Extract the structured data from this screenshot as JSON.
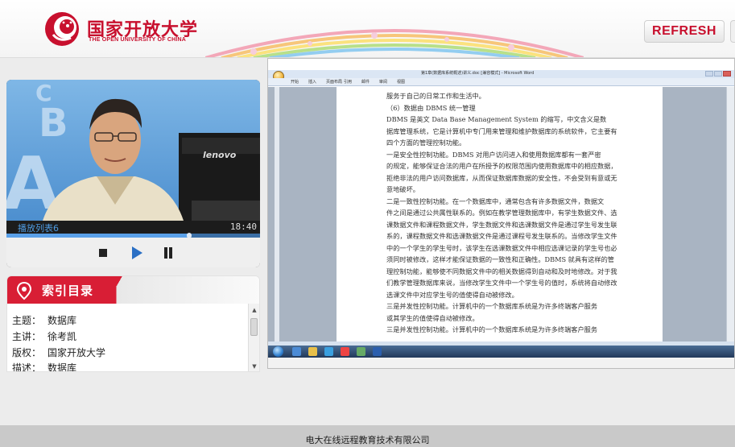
{
  "header": {
    "brand_cn": "国家开放大学",
    "brand_en": "THE OPEN UNIVERSITY OF CHINA",
    "refresh_label": "REFRESH",
    "brand_color": "#c8102e"
  },
  "video": {
    "playlist_title": "播放列表6",
    "time": "18:40",
    "progress": 0.72,
    "icons": [
      "stop-icon",
      "play-icon",
      "pause-icon"
    ]
  },
  "index": {
    "title": "索引目录",
    "rows": [
      {
        "key": "主题：",
        "value": "数据库"
      },
      {
        "key": "主讲：",
        "value": "徐考凯"
      },
      {
        "key": "版权：",
        "value": "国家开放大学"
      },
      {
        "key": "描述：",
        "value": "数据库"
      }
    ]
  },
  "document": {
    "lines": [
      "服务于自己的日常工作和生活中。",
      "（6）数据由 DBMS 统一管理",
      "DBMS 是英文 Data Base Management System 的缩写，中文含义是数",
      "据库管理系统，它是计算机中专门用来管理和维护数据库的系统软件，它主要有",
      "四个方面的管理控制功能。",
      "一是安全性控制功能。DBMS 对用户访问进入和使用数据库都有一套严密",
      "的规定，能够保证合法的用户在所授予的权限范围内使用数据库中的相应数据，",
      "拒绝非法的用户访问数据库，从而保证数据库数据的安全性，不会受到有意或无",
      "意地破坏。",
      "二是一致性控制功能。在一个数据库中，通常包含有许多数据文件，数据文",
      "件之间是通过公共属性联系的。例如在教学管理数据库中，有学生数据文件、选",
      "课数据文件和课程数据文件，学生数据文件和选课数据文件是通过学生号发生联",
      "系的，课程数据文件和选课数据文件是通过课程号发生联系的。当修改学生文件",
      "中的一个学生的学生号时，该学生在选课数据文件中相应选课记录的学生号也必",
      "须同时被修改，这样才能保证数据的一致性和正确性。DBMS 就具有这样的管",
      "理控制功能，能够使不同数据文件中的相关数据得到自动和及时地修改。对于我",
      "们教学管理数据库来说，当修改学生文件中一个学生号的值时，系统将自动修改",
      "选课文件中对应学生号的值使得自动被修改。",
      "三是并发性控制功能。计算机中的一个数据库系统是为许多终端客户服务",
      "或其学生的值使得自动被修改。",
      "三是并发性控制功能。计算机中的一个数据库系统是为许多终端客户服务"
    ],
    "ribbon_tabs": [
      "开始",
      "插入",
      "页面布局",
      "引用",
      "邮件",
      "审阅",
      "视图"
    ],
    "window_title": "第1章(数据库系统概述)讲义.doc [兼容模式] - Microsoft Word"
  },
  "footer": {
    "text": "电大在线远程教育技术有限公司"
  }
}
